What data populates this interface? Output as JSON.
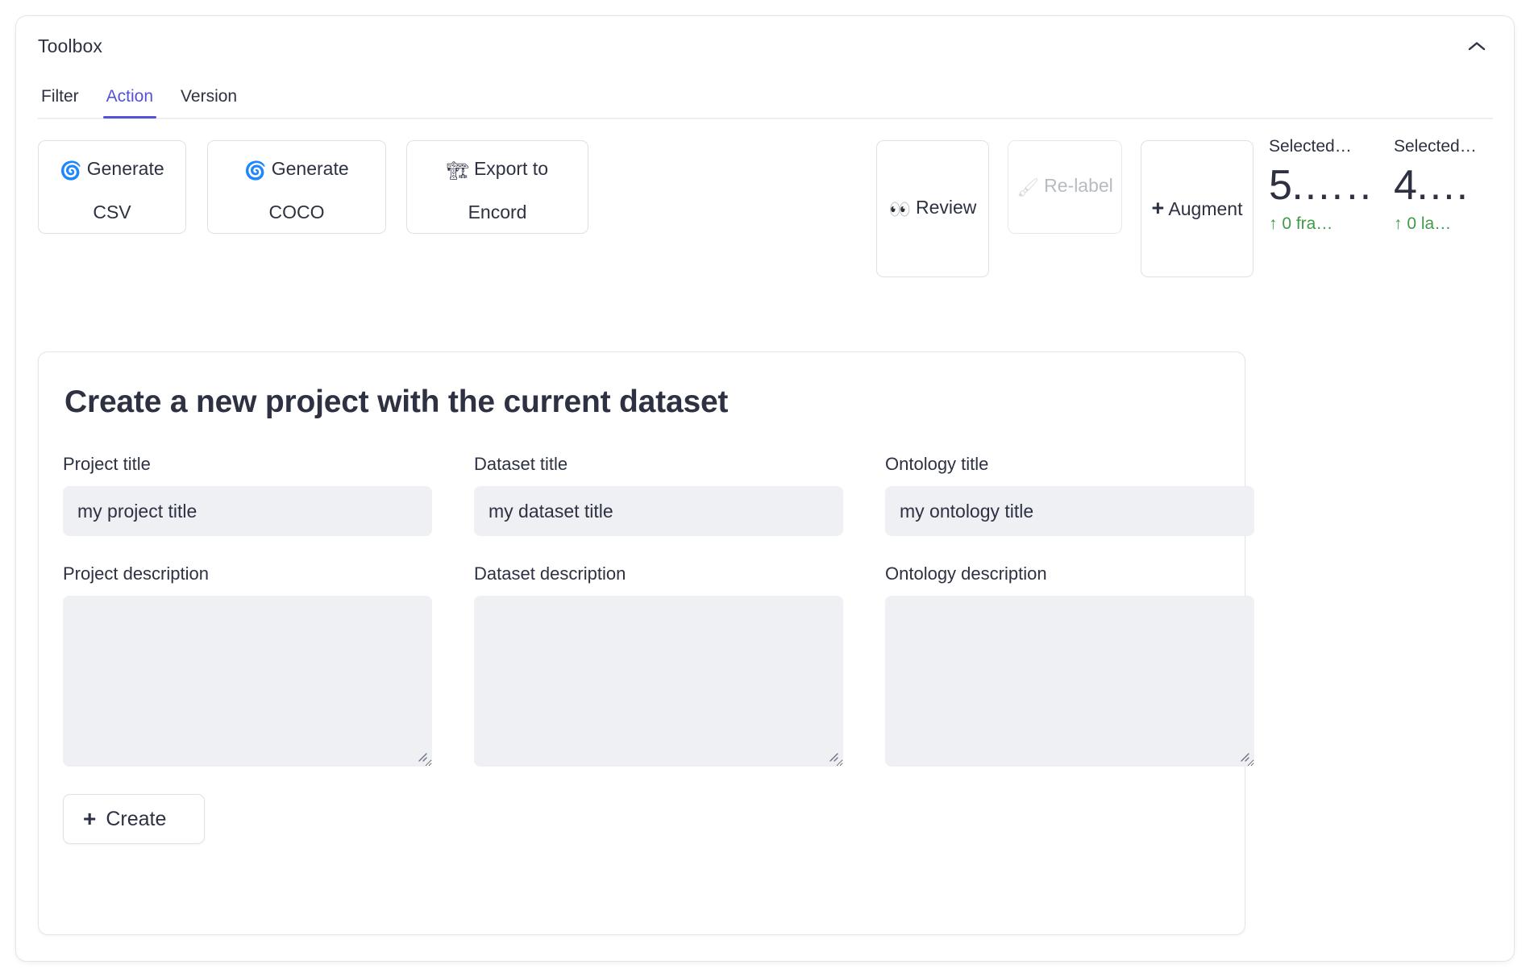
{
  "panel": {
    "title": "Toolbox",
    "collapse_icon": "chevron-up-icon"
  },
  "tabs": [
    {
      "label": "Filter",
      "active": false
    },
    {
      "label": "Action",
      "active": true
    },
    {
      "label": "Version",
      "active": false
    }
  ],
  "actions": {
    "generate_csv": {
      "label": "Generate CSV",
      "icon": "🌀",
      "icon_name": "cyclone-icon",
      "disabled": false
    },
    "generate_coco": {
      "label": "Generate COCO",
      "icon": "🌀",
      "icon_name": "cyclone-icon",
      "disabled": false
    },
    "export_encord": {
      "label": "Export to Encord",
      "icon": "🏗",
      "icon_name": "building-construction-icon",
      "disabled": false
    },
    "review": {
      "label": "Review",
      "icon": "👀",
      "icon_name": "eyes-icon",
      "disabled": false
    },
    "relabel": {
      "label": "Re-label",
      "icon": "🖌",
      "icon_name": "paintbrush-icon",
      "disabled": true
    },
    "augment": {
      "label": "Augment",
      "icon": "+",
      "icon_name": "plus-icon",
      "disabled": false
    }
  },
  "stats": [
    {
      "label": "Selected…",
      "value": "5.……",
      "delta": "↑ 0 fra…"
    },
    {
      "label": "Selected…",
      "value": "4.…",
      "delta": "↑ 0 la…"
    }
  ],
  "create_card": {
    "title": "Create a new project with the current dataset",
    "fields": {
      "project_title": {
        "label": "Project title",
        "placeholder": "my project title",
        "value": ""
      },
      "dataset_title": {
        "label": "Dataset title",
        "placeholder": "my dataset title",
        "value": ""
      },
      "ontology_title": {
        "label": "Ontology title",
        "placeholder": "my ontology title",
        "value": ""
      },
      "project_description": {
        "label": "Project description",
        "placeholder": "",
        "value": ""
      },
      "dataset_description": {
        "label": "Dataset description",
        "placeholder": "",
        "value": ""
      },
      "ontology_description": {
        "label": "Ontology description",
        "placeholder": "",
        "value": ""
      }
    },
    "create_button": {
      "label": "Create",
      "icon": "+"
    }
  },
  "colors": {
    "accent": "#5453d6",
    "text": "#2d3142",
    "positive": "#419a48",
    "field_bg": "#eef0f4",
    "border": "#e3e5e8"
  }
}
